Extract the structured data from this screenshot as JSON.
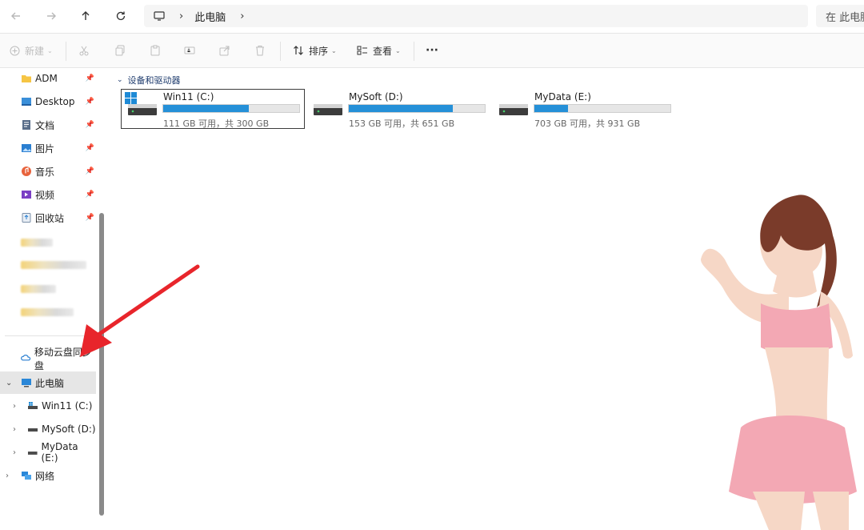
{
  "nav": {
    "breadcrumb": "此电脑",
    "search_placeholder": "在 此电脑"
  },
  "toolbar": {
    "new_label": "新建",
    "sort_label": "排序",
    "view_label": "查看",
    "more_label": "···"
  },
  "sidebar": {
    "quick": [
      {
        "label": "ADM",
        "icon": "folder-icon"
      },
      {
        "label": "Desktop",
        "icon": "desktop-folder-icon"
      },
      {
        "label": "文档",
        "icon": "documents-icon"
      },
      {
        "label": "图片",
        "icon": "pictures-icon"
      },
      {
        "label": "音乐",
        "icon": "music-icon"
      },
      {
        "label": "视频",
        "icon": "videos-icon"
      },
      {
        "label": "回收站",
        "icon": "recycle-bin-icon"
      }
    ],
    "cloud_sync": "移动云盘同步盘",
    "this_pc": "此电脑",
    "drives": [
      "Win11 (C:)",
      "MySoft (D:)",
      "MyData (E:)"
    ],
    "network": "网络"
  },
  "content": {
    "group_title": "设备和驱动器",
    "drives": [
      {
        "name": "Win11 (C:)",
        "free": "111 GB 可用，共 300 GB",
        "used_fraction": 0.63,
        "bar_color": "#2590d8"
      },
      {
        "name": "MySoft (D:)",
        "free": "153 GB 可用，共 651 GB",
        "used_fraction": 0.765,
        "bar_color": "#2590d8"
      },
      {
        "name": "MyData (E:)",
        "free": "703 GB 可用，共 931 GB",
        "used_fraction": 0.245,
        "bar_color": "#2590d8"
      }
    ]
  },
  "colors": {
    "accent": "#2590d8",
    "arrow": "#e8252b"
  }
}
